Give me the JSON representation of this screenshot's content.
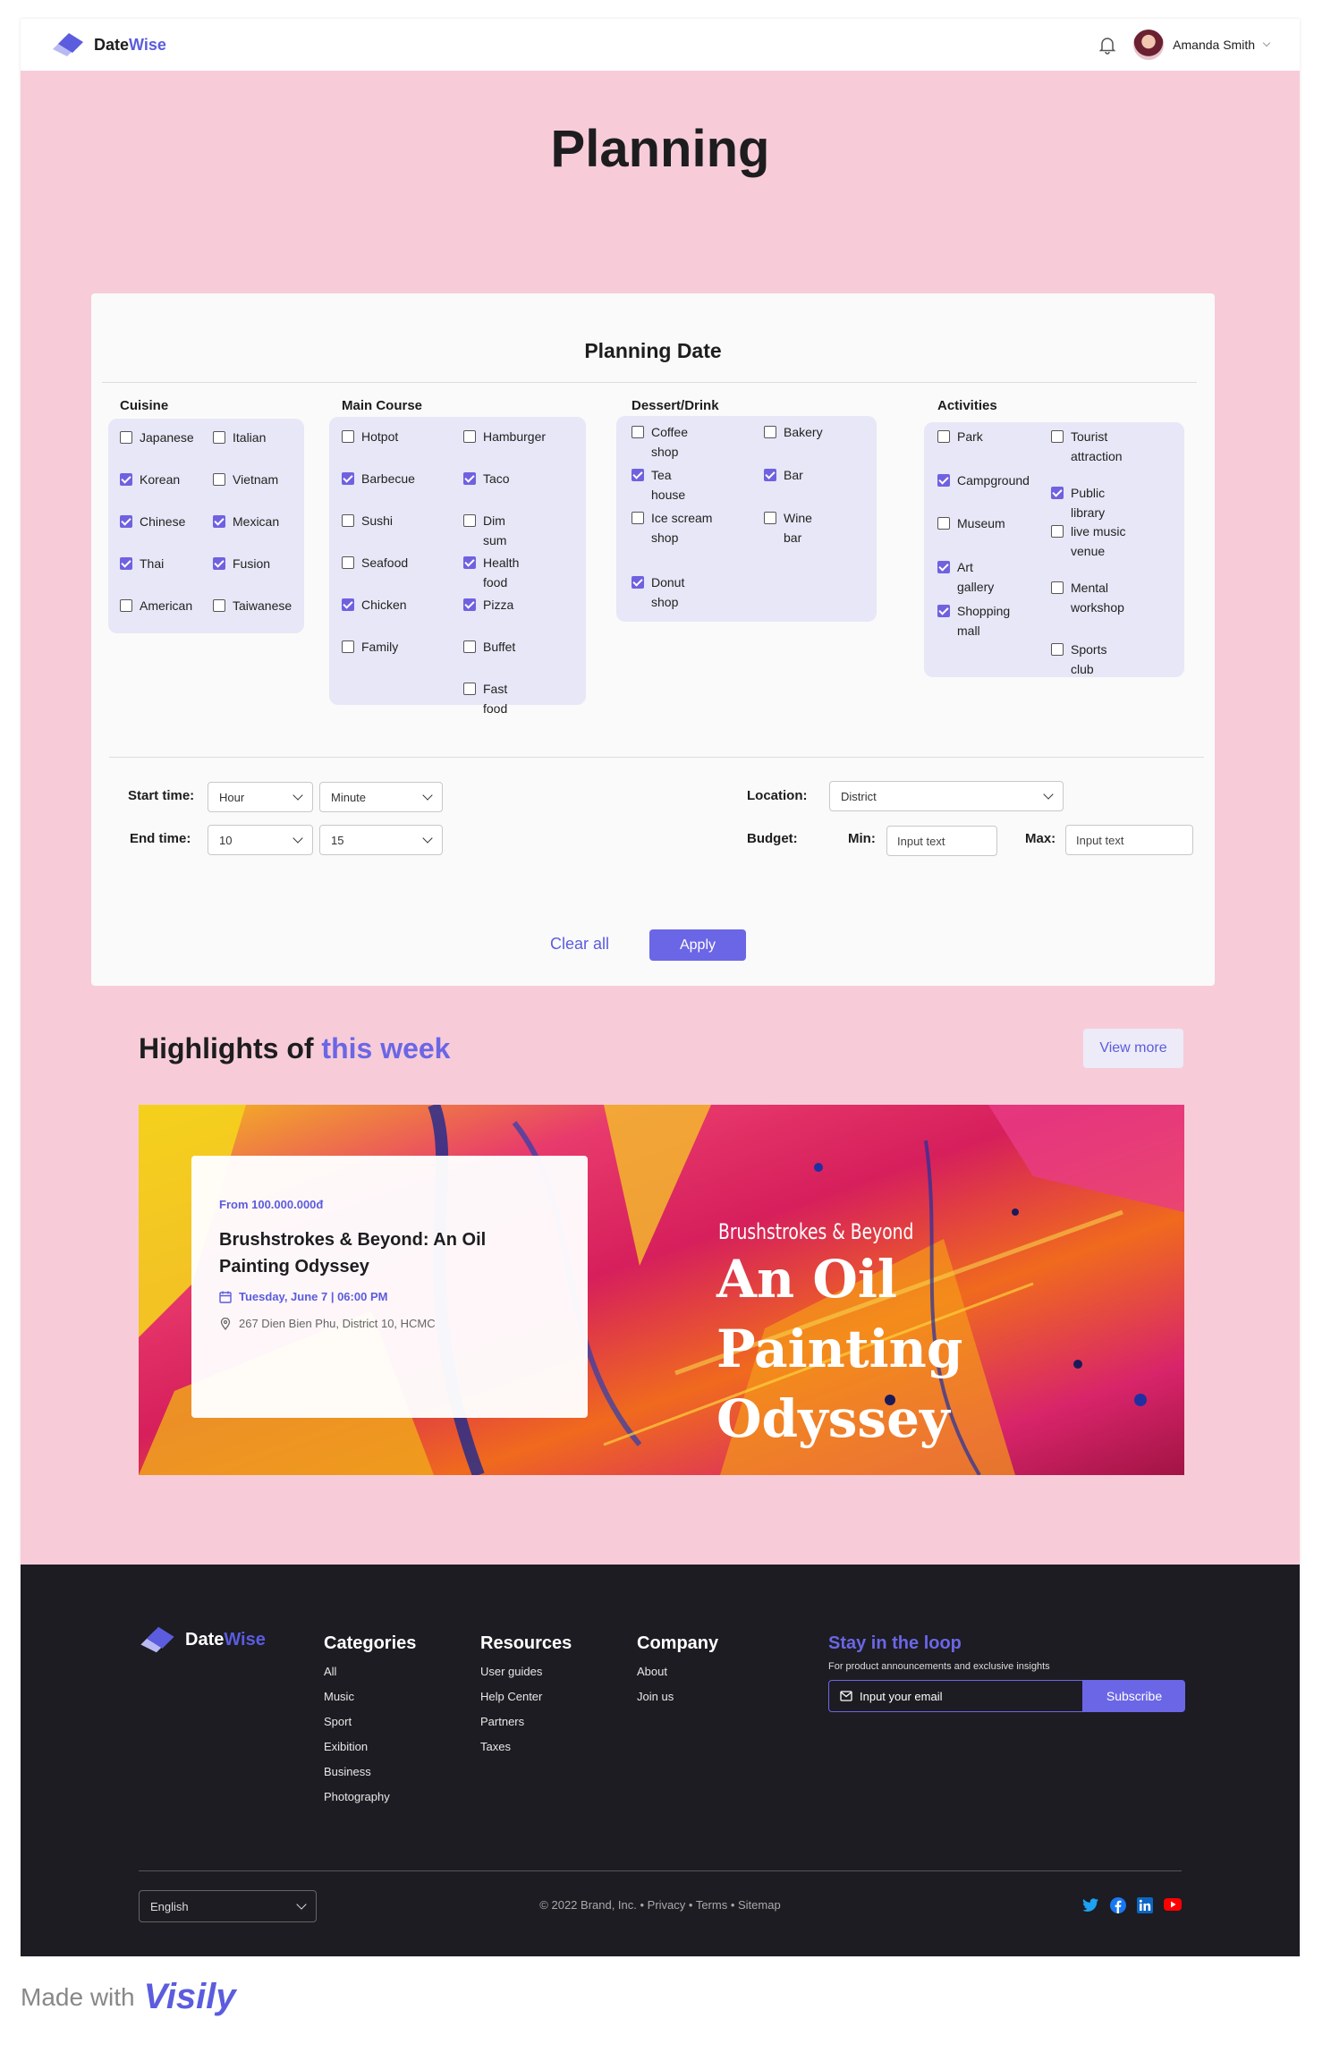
{
  "brand": {
    "name_a": "Date",
    "name_b": "Wise"
  },
  "user": {
    "name": "Amanda Smith"
  },
  "page": {
    "title": "Planning"
  },
  "planning": {
    "title": "Planning Date",
    "cuisine": {
      "title": "Cuisine",
      "options": [
        {
          "label": "Japanese",
          "checked": false
        },
        {
          "label": "Italian",
          "checked": false
        },
        {
          "label": "Korean",
          "checked": true
        },
        {
          "label": "Vietnam",
          "checked": false
        },
        {
          "label": "Chinese",
          "checked": true
        },
        {
          "label": "Mexican",
          "checked": true
        },
        {
          "label": "Thai",
          "checked": true
        },
        {
          "label": "Fusion",
          "checked": true
        },
        {
          "label": "American",
          "checked": false
        },
        {
          "label": "Taiwanese",
          "checked": false
        }
      ]
    },
    "main": {
      "title": "Main Course",
      "options": [
        {
          "label": "Hotpot",
          "checked": false
        },
        {
          "label": "Hamburger",
          "checked": false
        },
        {
          "label": "Barbecue",
          "checked": true
        },
        {
          "label": "Taco",
          "checked": true
        },
        {
          "label": "Sushi",
          "checked": false
        },
        {
          "label": "Dim sum",
          "checked": false
        },
        {
          "label": "Seafood",
          "checked": false
        },
        {
          "label": "Health food",
          "checked": true
        },
        {
          "label": "Chicken",
          "checked": true
        },
        {
          "label": "Pizza",
          "checked": true
        },
        {
          "label": "Family",
          "checked": false
        },
        {
          "label": "Buffet",
          "checked": false
        },
        {
          "label": "Fast food",
          "checked": false
        }
      ]
    },
    "dessert": {
      "title": "Dessert/Drink",
      "options": [
        {
          "label": "Coffee shop",
          "checked": false
        },
        {
          "label": "Bakery",
          "checked": false
        },
        {
          "label": "Tea house",
          "checked": true
        },
        {
          "label": "Bar",
          "checked": true
        },
        {
          "label": "Ice scream shop",
          "checked": false
        },
        {
          "label": "Wine bar",
          "checked": false
        },
        {
          "label": "Donut shop",
          "checked": true
        }
      ]
    },
    "activities": {
      "title": "Activities",
      "options": [
        {
          "label": "Park",
          "checked": false
        },
        {
          "label": "Tourist attraction",
          "checked": false
        },
        {
          "label": "Campground",
          "checked": true
        },
        {
          "label": "Public library",
          "checked": true
        },
        {
          "label": "Museum",
          "checked": false
        },
        {
          "label": "live music venue",
          "checked": false
        },
        {
          "label": "Art gallery",
          "checked": true
        },
        {
          "label": "Mental workshop",
          "checked": false
        },
        {
          "label": "Shopping mall",
          "checked": true
        },
        {
          "label": "Sports club",
          "checked": false
        }
      ]
    },
    "start_label": "Start time:",
    "end_label": "End time:",
    "start_hour": "Hour",
    "start_minute": "Minute",
    "end_hour": "10",
    "end_minute": "15",
    "location_label": "Location:",
    "location_value": "District",
    "budget_label": "Budget:",
    "min_label": "Min:",
    "max_label": "Max:",
    "min_placeholder": "Input text",
    "max_placeholder": "Input text",
    "clear_label": "Clear all",
    "apply_label": "Apply"
  },
  "highlights": {
    "title_a": "Highlights of",
    "title_b": "this week",
    "view_more": "View more",
    "event": {
      "price": "From  100.000.000đ",
      "title": "Brushstrokes & Beyond: An Oil Painting Odyssey",
      "date": "Tuesday, June 7 | 06:00 PM",
      "address": "267 Dien Bien Phu, District 10, HCMC"
    },
    "banner_small": "Brushstrokes & Beyond",
    "banner_big": "An Oil Painting Odyssey"
  },
  "footer": {
    "categories": {
      "title": "Categories",
      "items": [
        "All",
        "Music",
        "Sport",
        "Exibition",
        "Business",
        "Photography"
      ]
    },
    "resources": {
      "title": "Resources",
      "items": [
        "User guides",
        "Help Center",
        "Partners",
        "Taxes"
      ]
    },
    "company": {
      "title": "Company",
      "items": [
        "About",
        "Join us"
      ]
    },
    "loop": {
      "title": "Stay in the loop",
      "text": "For product announcements and exclusive insights",
      "placeholder": "Input your email",
      "button": "Subscribe"
    },
    "language": "English",
    "copyright": "© 2022 Brand, Inc. • Privacy • Terms • Sitemap"
  },
  "madewith": {
    "text": "Made with",
    "logo": "Visily"
  },
  "colors": {
    "accent": "#6b66e6",
    "background": "#f7ccd8",
    "footer": "#1c1c22"
  }
}
